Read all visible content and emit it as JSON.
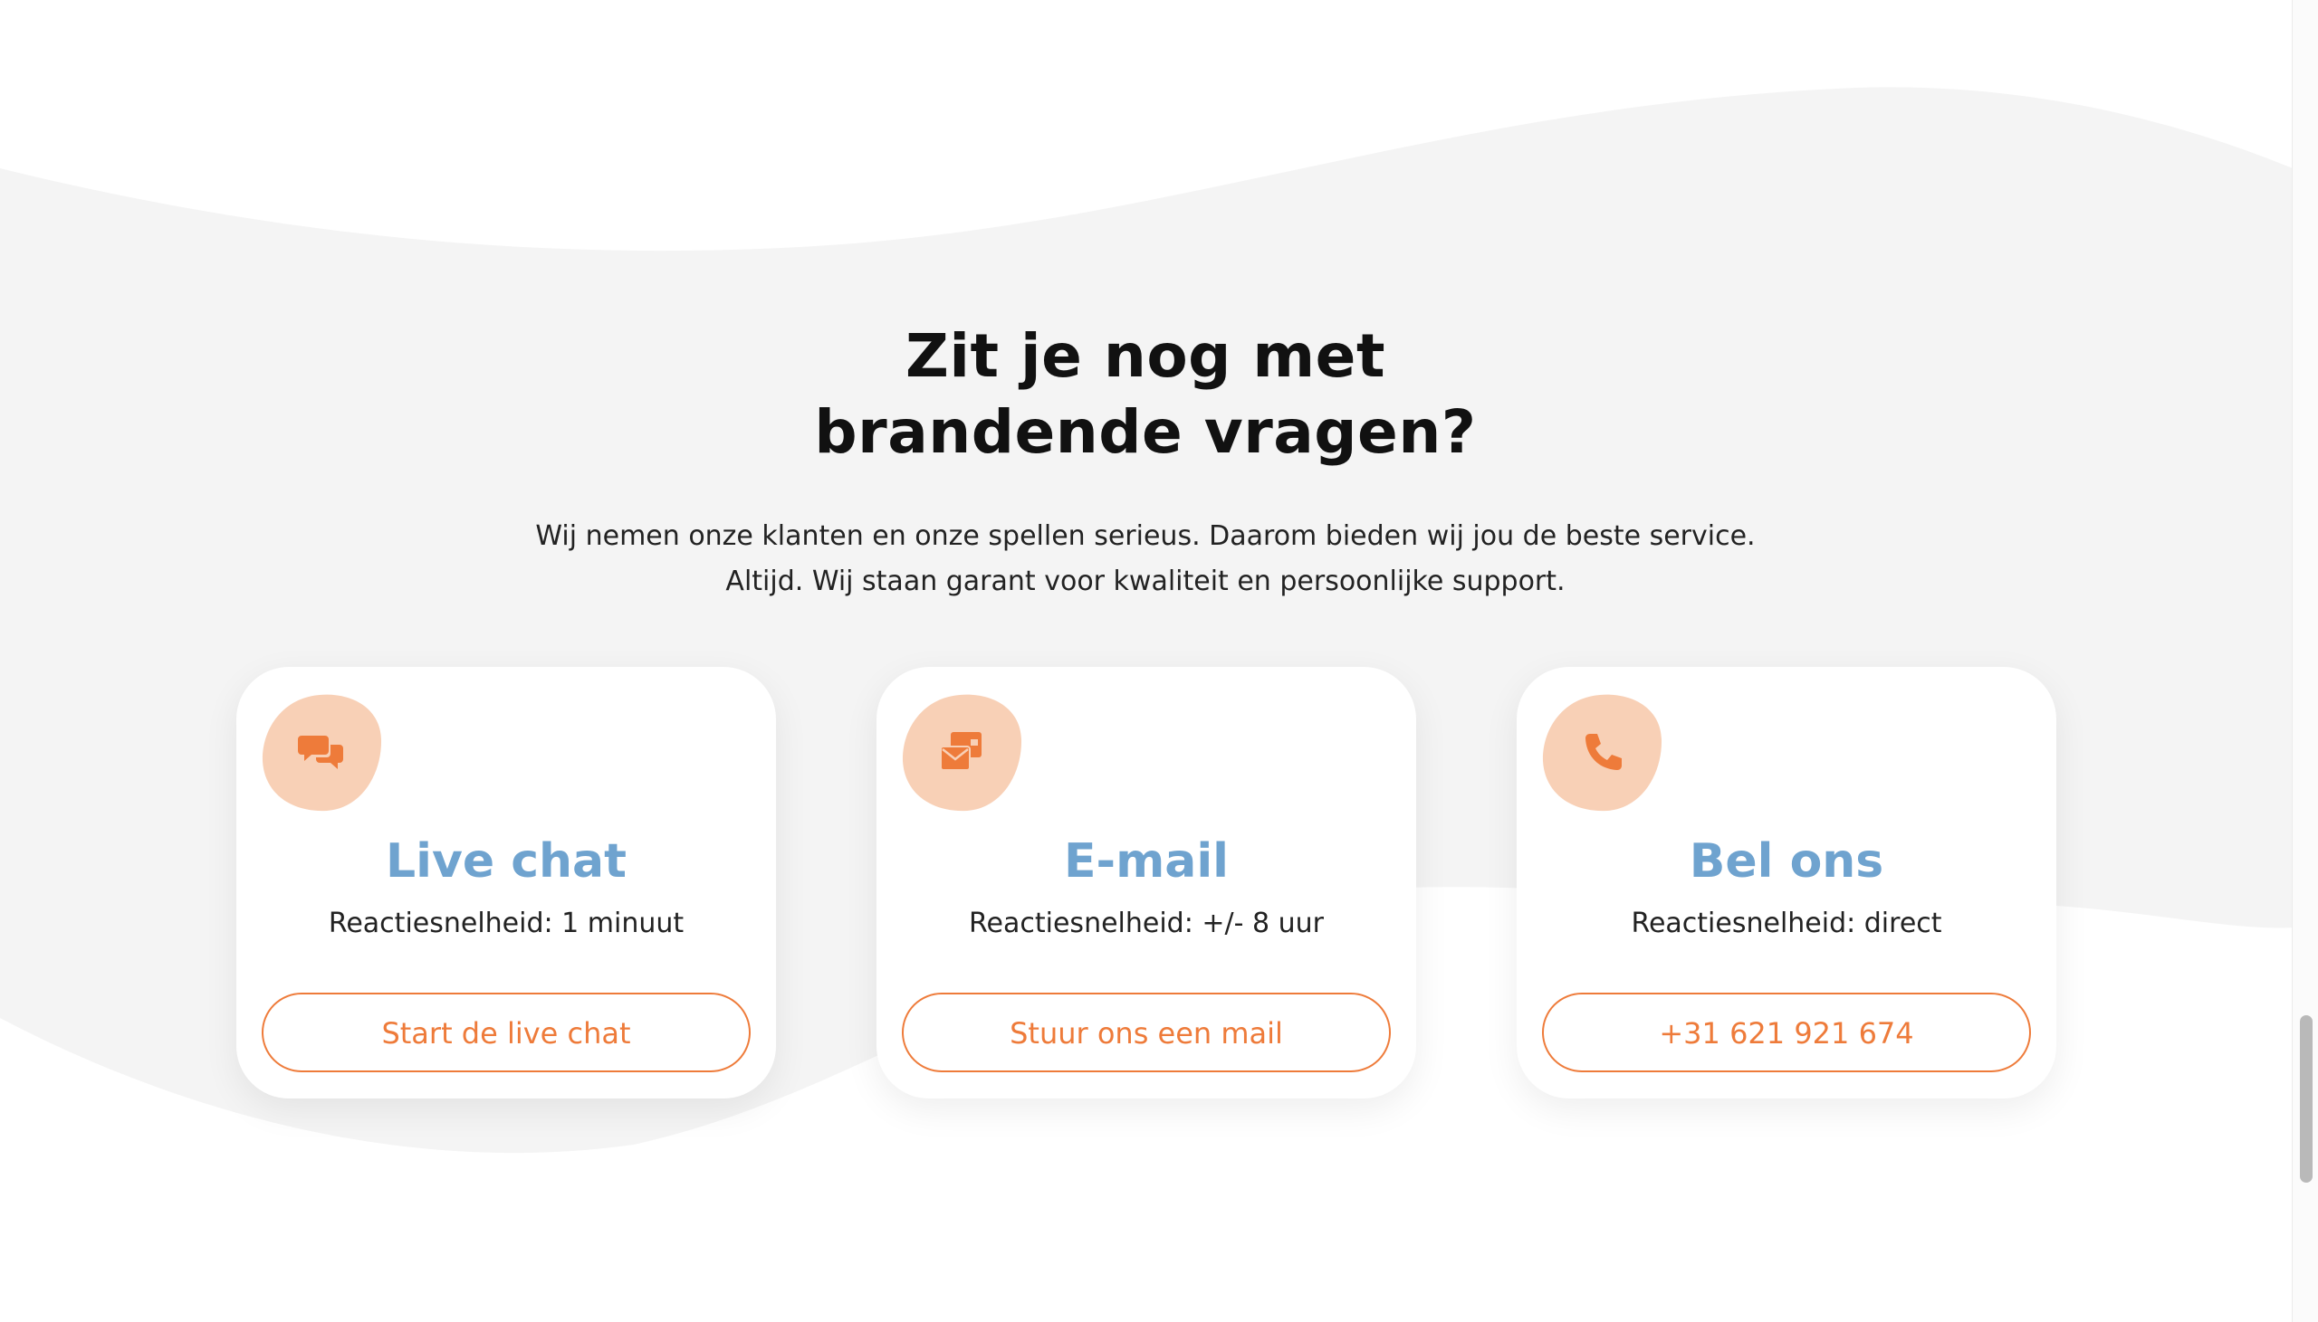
{
  "section": {
    "heading_line1": "Zit je nog met",
    "heading_line2": "brandende vragen?",
    "subtext_line1": "Wij nemen onze klanten en onze spellen serieus. Daarom bieden wij jou de beste service.",
    "subtext_line2": "Altijd. Wij staan garant voor kwaliteit en persoonlijke support."
  },
  "colors": {
    "accent": "#ee7b3a",
    "icon_blob": "#f8d0b6",
    "title_blue": "#6fa3cf",
    "wave_gray": "#f4f4f4"
  },
  "cards": [
    {
      "icon": "chat-bubbles-icon",
      "title": "Live chat",
      "meta": "Reactiesnelheid: 1 minuut",
      "button": "Start de live chat"
    },
    {
      "icon": "mail-icon",
      "title": "E-mail",
      "meta": "Reactiesnelheid: +/- 8 uur",
      "button": "Stuur ons een mail"
    },
    {
      "icon": "phone-icon",
      "title": "Bel ons",
      "meta": "Reactiesnelheid: direct",
      "button": "+31 621 921 674"
    }
  ]
}
